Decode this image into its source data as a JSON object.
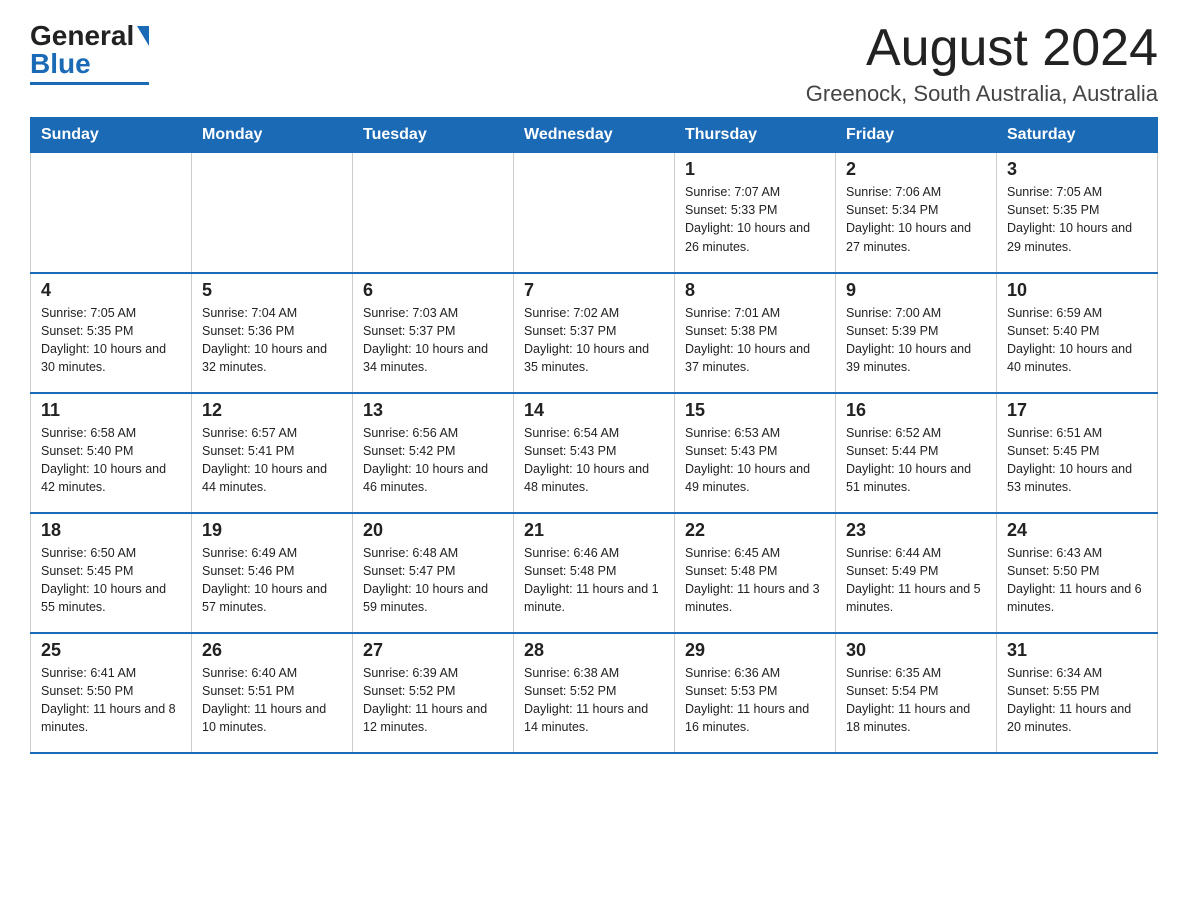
{
  "logo": {
    "text_general": "General",
    "text_blue": "Blue"
  },
  "header": {
    "month_title": "August 2024",
    "location": "Greenock, South Australia, Australia"
  },
  "days_of_week": [
    "Sunday",
    "Monday",
    "Tuesday",
    "Wednesday",
    "Thursday",
    "Friday",
    "Saturday"
  ],
  "weeks": [
    [
      {
        "day": "",
        "info": ""
      },
      {
        "day": "",
        "info": ""
      },
      {
        "day": "",
        "info": ""
      },
      {
        "day": "",
        "info": ""
      },
      {
        "day": "1",
        "info": "Sunrise: 7:07 AM\nSunset: 5:33 PM\nDaylight: 10 hours and 26 minutes."
      },
      {
        "day": "2",
        "info": "Sunrise: 7:06 AM\nSunset: 5:34 PM\nDaylight: 10 hours and 27 minutes."
      },
      {
        "day": "3",
        "info": "Sunrise: 7:05 AM\nSunset: 5:35 PM\nDaylight: 10 hours and 29 minutes."
      }
    ],
    [
      {
        "day": "4",
        "info": "Sunrise: 7:05 AM\nSunset: 5:35 PM\nDaylight: 10 hours and 30 minutes."
      },
      {
        "day": "5",
        "info": "Sunrise: 7:04 AM\nSunset: 5:36 PM\nDaylight: 10 hours and 32 minutes."
      },
      {
        "day": "6",
        "info": "Sunrise: 7:03 AM\nSunset: 5:37 PM\nDaylight: 10 hours and 34 minutes."
      },
      {
        "day": "7",
        "info": "Sunrise: 7:02 AM\nSunset: 5:37 PM\nDaylight: 10 hours and 35 minutes."
      },
      {
        "day": "8",
        "info": "Sunrise: 7:01 AM\nSunset: 5:38 PM\nDaylight: 10 hours and 37 minutes."
      },
      {
        "day": "9",
        "info": "Sunrise: 7:00 AM\nSunset: 5:39 PM\nDaylight: 10 hours and 39 minutes."
      },
      {
        "day": "10",
        "info": "Sunrise: 6:59 AM\nSunset: 5:40 PM\nDaylight: 10 hours and 40 minutes."
      }
    ],
    [
      {
        "day": "11",
        "info": "Sunrise: 6:58 AM\nSunset: 5:40 PM\nDaylight: 10 hours and 42 minutes."
      },
      {
        "day": "12",
        "info": "Sunrise: 6:57 AM\nSunset: 5:41 PM\nDaylight: 10 hours and 44 minutes."
      },
      {
        "day": "13",
        "info": "Sunrise: 6:56 AM\nSunset: 5:42 PM\nDaylight: 10 hours and 46 minutes."
      },
      {
        "day": "14",
        "info": "Sunrise: 6:54 AM\nSunset: 5:43 PM\nDaylight: 10 hours and 48 minutes."
      },
      {
        "day": "15",
        "info": "Sunrise: 6:53 AM\nSunset: 5:43 PM\nDaylight: 10 hours and 49 minutes."
      },
      {
        "day": "16",
        "info": "Sunrise: 6:52 AM\nSunset: 5:44 PM\nDaylight: 10 hours and 51 minutes."
      },
      {
        "day": "17",
        "info": "Sunrise: 6:51 AM\nSunset: 5:45 PM\nDaylight: 10 hours and 53 minutes."
      }
    ],
    [
      {
        "day": "18",
        "info": "Sunrise: 6:50 AM\nSunset: 5:45 PM\nDaylight: 10 hours and 55 minutes."
      },
      {
        "day": "19",
        "info": "Sunrise: 6:49 AM\nSunset: 5:46 PM\nDaylight: 10 hours and 57 minutes."
      },
      {
        "day": "20",
        "info": "Sunrise: 6:48 AM\nSunset: 5:47 PM\nDaylight: 10 hours and 59 minutes."
      },
      {
        "day": "21",
        "info": "Sunrise: 6:46 AM\nSunset: 5:48 PM\nDaylight: 11 hours and 1 minute."
      },
      {
        "day": "22",
        "info": "Sunrise: 6:45 AM\nSunset: 5:48 PM\nDaylight: 11 hours and 3 minutes."
      },
      {
        "day": "23",
        "info": "Sunrise: 6:44 AM\nSunset: 5:49 PM\nDaylight: 11 hours and 5 minutes."
      },
      {
        "day": "24",
        "info": "Sunrise: 6:43 AM\nSunset: 5:50 PM\nDaylight: 11 hours and 6 minutes."
      }
    ],
    [
      {
        "day": "25",
        "info": "Sunrise: 6:41 AM\nSunset: 5:50 PM\nDaylight: 11 hours and 8 minutes."
      },
      {
        "day": "26",
        "info": "Sunrise: 6:40 AM\nSunset: 5:51 PM\nDaylight: 11 hours and 10 minutes."
      },
      {
        "day": "27",
        "info": "Sunrise: 6:39 AM\nSunset: 5:52 PM\nDaylight: 11 hours and 12 minutes."
      },
      {
        "day": "28",
        "info": "Sunrise: 6:38 AM\nSunset: 5:52 PM\nDaylight: 11 hours and 14 minutes."
      },
      {
        "day": "29",
        "info": "Sunrise: 6:36 AM\nSunset: 5:53 PM\nDaylight: 11 hours and 16 minutes."
      },
      {
        "day": "30",
        "info": "Sunrise: 6:35 AM\nSunset: 5:54 PM\nDaylight: 11 hours and 18 minutes."
      },
      {
        "day": "31",
        "info": "Sunrise: 6:34 AM\nSunset: 5:55 PM\nDaylight: 11 hours and 20 minutes."
      }
    ]
  ]
}
